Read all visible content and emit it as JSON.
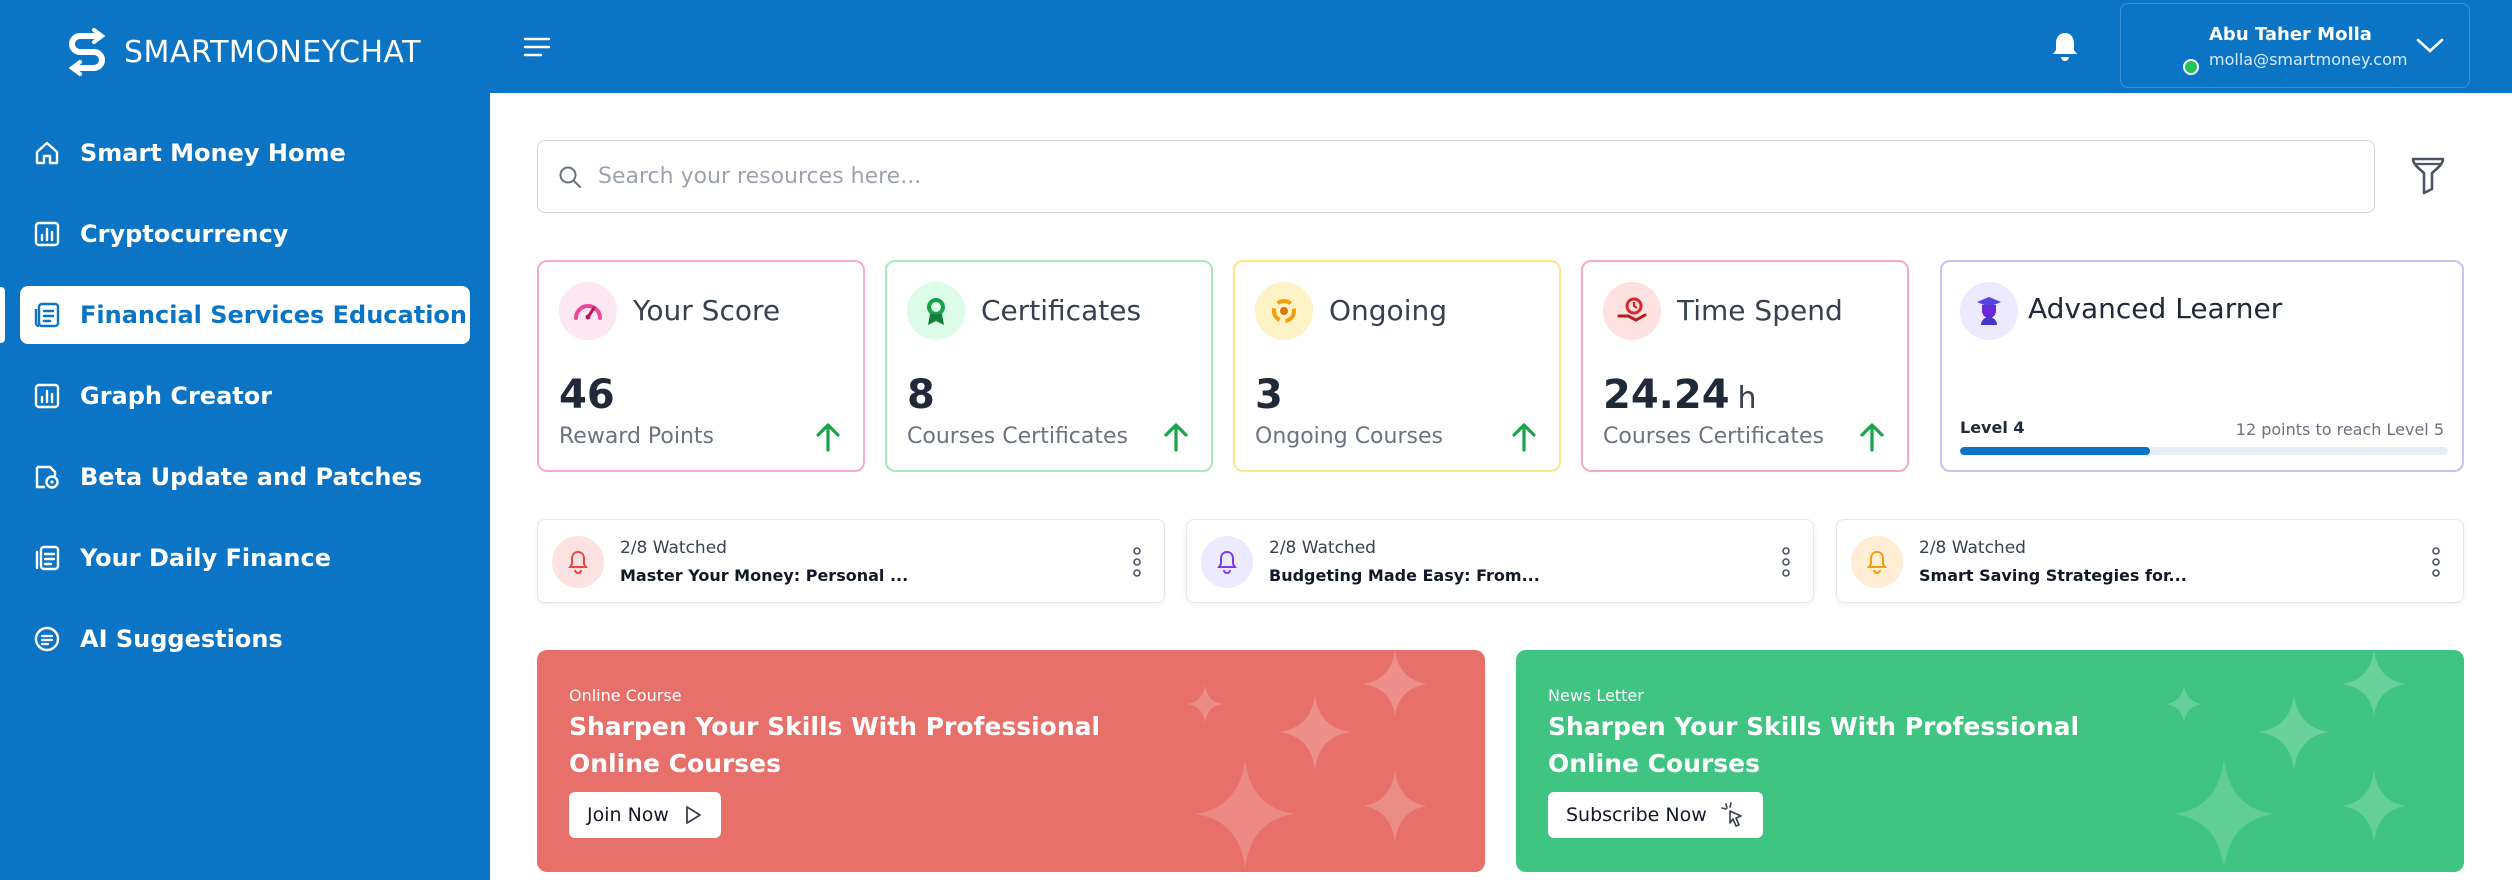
{
  "brand": {
    "name": "SMARTMONEYCHAT"
  },
  "sidebar": {
    "items": [
      {
        "label": "Smart Money Home",
        "icon": "home-icon",
        "active": false
      },
      {
        "label": "Cryptocurrency",
        "icon": "bar-chart-icon",
        "active": false
      },
      {
        "label": "Financial Services Education",
        "icon": "document-icon",
        "active": true
      },
      {
        "label": "Graph Creator",
        "icon": "bar-chart-icon",
        "active": false
      },
      {
        "label": "Beta Update and Patches",
        "icon": "patch-icon",
        "active": false
      },
      {
        "label": "Your Daily Finance",
        "icon": "finance-doc-icon",
        "active": false
      },
      {
        "label": "AI Suggestions",
        "icon": "list-circle-icon",
        "active": false
      }
    ]
  },
  "header": {
    "user_name": "Abu Taher Molla",
    "user_email": "molla@smartmoney.com",
    "status_color": "#22c55e"
  },
  "search": {
    "placeholder": "Search your resources here..."
  },
  "stats": [
    {
      "title": "Your Score",
      "value": "46",
      "unit": "",
      "label": "Reward Points",
      "border": "#f9a8d4",
      "icon_bg": "#fce7f3",
      "icon": "gauge-icon"
    },
    {
      "title": "Certificates",
      "value": "8",
      "unit": "",
      "label": "Courses Certificates",
      "border": "#a7e9b9",
      "icon_bg": "#dcfce7",
      "icon": "award-icon"
    },
    {
      "title": "Ongoing",
      "value": "3",
      "unit": "",
      "label": "Ongoing Courses",
      "border": "#fde68a",
      "icon_bg": "#fef3c7",
      "icon": "spinner-icon"
    },
    {
      "title": "Time Spend",
      "value": "24.24",
      "unit": "h",
      "label": "Courses Certificates",
      "border": "#f9a8c4",
      "icon_bg": "#fee2e2",
      "icon": "hand-clock-icon"
    }
  ],
  "level": {
    "title": "Advanced Learner",
    "level_label": "Level 4",
    "next_label": "12 points to reach Level 5",
    "progress": 0.39
  },
  "watching": [
    {
      "count": "2/8 Watched",
      "title": "Master Your Money: Personal ...",
      "icon_bg": "#fde2e2",
      "icon_color": "#ef4444"
    },
    {
      "count": "2/8 Watched",
      "title": "Budgeting Made Easy: From...",
      "icon_bg": "#ede9fe",
      "icon_color": "#7c3aed"
    },
    {
      "count": "2/8 Watched",
      "title": "Smart Saving Strategies for...",
      "icon_bg": "#ffedd5",
      "icon_color": "#f59e0b"
    }
  ],
  "banners": [
    {
      "tag": "Online Course",
      "title": "Sharpen  Your Skills With Professional Online Courses",
      "button": "Join Now",
      "bg": "#e8706a"
    },
    {
      "tag": "News Letter",
      "title": "Sharpen  Your Skills With Professional Online Courses",
      "button": "Subscribe Now",
      "bg": "#3fc482"
    }
  ]
}
